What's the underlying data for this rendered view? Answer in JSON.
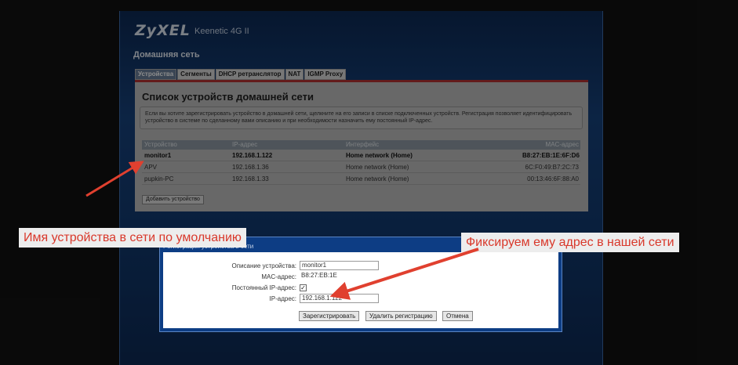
{
  "header": {
    "logo": "ZyXEL",
    "model": "Keenetic 4G II",
    "section": "Домашняя сеть"
  },
  "tabs": [
    {
      "label": "Устройства",
      "active": true
    },
    {
      "label": "Сегменты"
    },
    {
      "label": "DHCP ретранслятор"
    },
    {
      "label": "NAT"
    },
    {
      "label": "IGMP Proxy"
    }
  ],
  "panel": {
    "title": "Список устройств домашней сети",
    "info": "Если вы хотите зарегистрировать устройство в домашней сети, щелкните на его записи в списке подключенных устройств. Регистрация позволяет идентифицировать устройство в системе по сделанному вами описанию и при необходимости назначить ему постоянный IP-адрес."
  },
  "table": {
    "columns": [
      "Устройство",
      "IP-адрес",
      "Интерфейс",
      "MAC-адрес"
    ],
    "rows": [
      [
        "monitor1",
        "192.168.1.122",
        "Home network (Home)",
        "B8:27:EB:1E:6F:D6"
      ],
      [
        "APV",
        "192.168.1.36",
        "Home network (Home)",
        "6C:F0:49:B7:2C:73"
      ],
      [
        "pupkin-PC",
        "192.168.1.33",
        "Home network (Home)",
        "00:13:46:6F:88:A0"
      ]
    ],
    "add_button": "Добавить устройство"
  },
  "dialog": {
    "title": "Регистрация устройства в сети",
    "desc_label": "Описание устройства:",
    "desc_value": "monitor1",
    "mac_label": "MAC-адрес:",
    "mac_value": "B8:27:EB:1E",
    "static_label": "Постоянный IP-адрес:",
    "static_checked": true,
    "ip_label": "IP-адрес:",
    "ip_value": "192.168.1.122",
    "btn_register": "Зарегистрировать",
    "btn_unregister": "Удалить регистрацию",
    "btn_cancel": "Отмена"
  },
  "callouts": {
    "left": "Имя устройства в сети по умолчанию",
    "right": "Фиксируем ему адрес в нашей сети"
  },
  "colors": {
    "arrow": "#e0402f",
    "header_red": "#b43232"
  }
}
